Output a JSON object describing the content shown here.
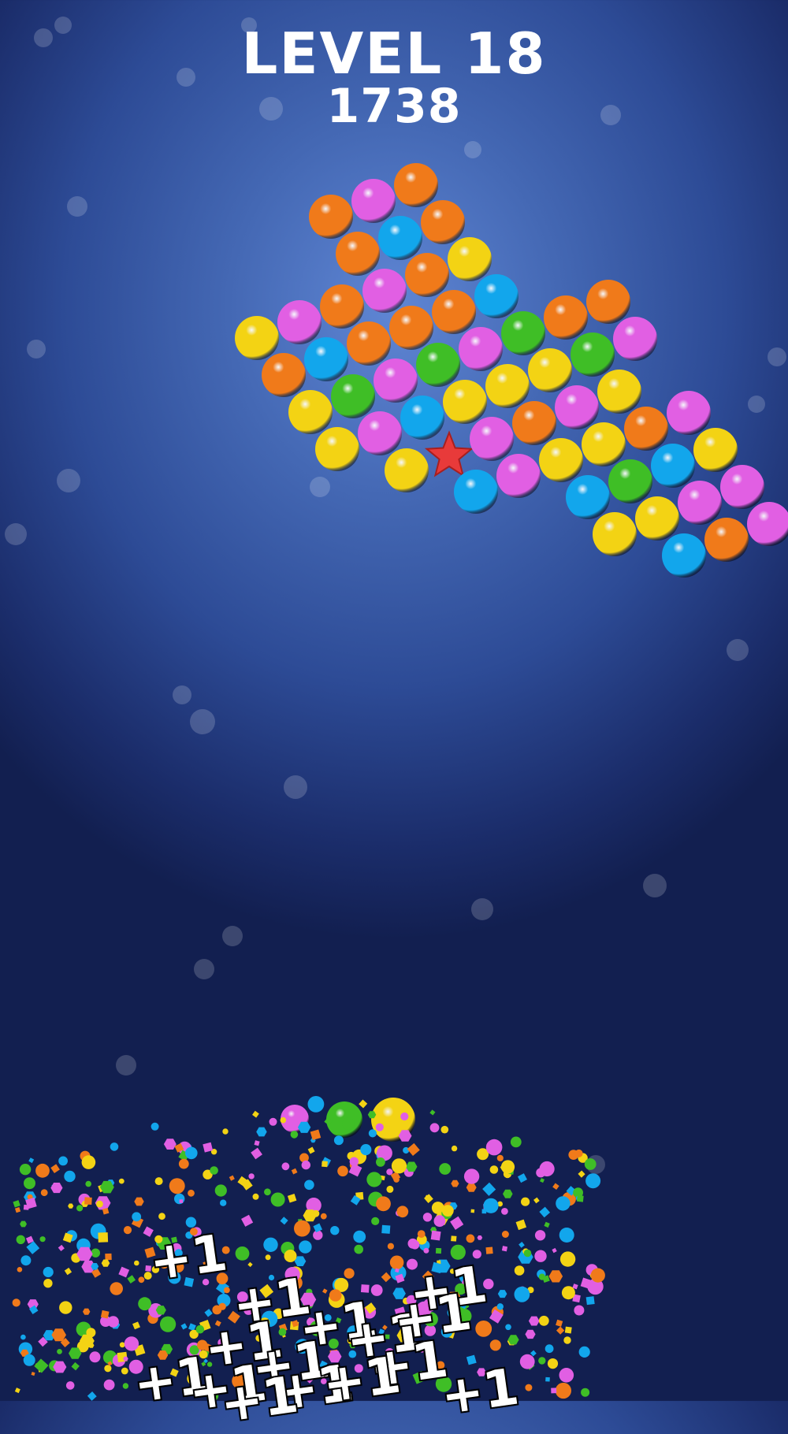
{
  "hud": {
    "level_label": "LEVEL 18",
    "score": "1738"
  },
  "colors": {
    "yellow": "#f3d314",
    "magenta": "#e15fe3",
    "orange": "#f07a1a",
    "blue": "#12a6ec",
    "green": "#3fbe26",
    "star": "#e83a3a"
  },
  "board": {
    "icon": "red-star-icon",
    "rows": [
      [
        "orange",
        "magenta",
        "orange"
      ],
      [
        "orange",
        "blue",
        "orange"
      ],
      [
        "yellow",
        "magenta",
        "orange",
        "magenta",
        "orange",
        "yellow"
      ],
      [
        "orange",
        "blue",
        "orange",
        "orange",
        "orange",
        "blue"
      ],
      [
        "yellow",
        "green",
        "magenta",
        "green",
        "magenta",
        "green",
        "orange",
        "orange"
      ],
      [
        "yellow",
        "magenta",
        "blue",
        "yellow",
        "yellow",
        "yellow",
        "green",
        "magenta"
      ],
      [
        "yellow",
        "star",
        "magenta",
        "orange",
        "magenta",
        "yellow"
      ],
      [
        "blue",
        "magenta",
        "yellow",
        "yellow",
        "orange",
        "magenta"
      ],
      [
        "blue",
        "green",
        "blue",
        "yellow"
      ],
      [
        "yellow",
        "yellow",
        "magenta",
        "magenta"
      ],
      [
        "blue",
        "orange",
        "magenta"
      ]
    ]
  },
  "launcher": {
    "queue": [
      "magenta",
      "green",
      "yellow"
    ]
  },
  "popups": [
    "+1",
    "+1",
    "+1",
    "+1",
    "+1",
    "+1",
    "+1",
    "+1",
    "+1",
    "+1",
    "+1",
    "+1",
    "+1",
    "+1",
    "+1"
  ]
}
